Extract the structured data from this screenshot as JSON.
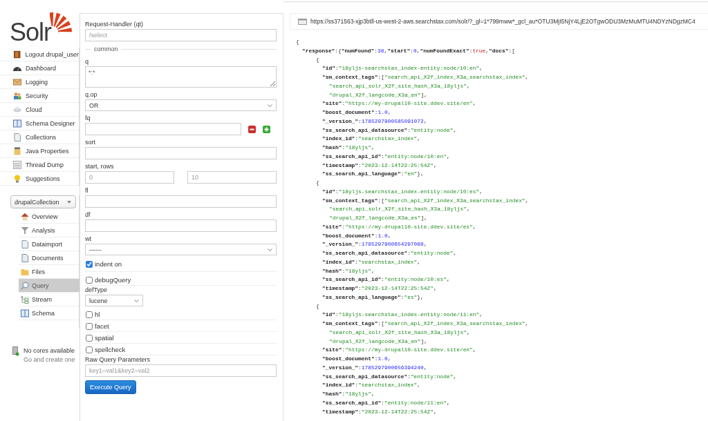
{
  "sidebar": {
    "logo": "Solr",
    "menu": [
      {
        "label": "Logout drupal_user"
      },
      {
        "label": "Dashboard"
      },
      {
        "label": "Logging"
      },
      {
        "label": "Security"
      },
      {
        "label": "Cloud"
      },
      {
        "label": "Schema Designer"
      },
      {
        "label": "Collections"
      },
      {
        "label": "Java Properties"
      },
      {
        "label": "Thread Dump"
      },
      {
        "label": "Suggestions"
      }
    ],
    "core_selector": "drupalCollection",
    "core_menu": [
      {
        "label": "Overview",
        "selected": false
      },
      {
        "label": "Analysis",
        "selected": false
      },
      {
        "label": "Dataimport",
        "selected": false
      },
      {
        "label": "Documents",
        "selected": false
      },
      {
        "label": "Files",
        "selected": false
      },
      {
        "label": "Query",
        "selected": true
      },
      {
        "label": "Stream",
        "selected": false
      },
      {
        "label": "Schema",
        "selected": false
      }
    ],
    "notice": {
      "title": "No cores available",
      "link": "Go and create one"
    }
  },
  "form": {
    "items": [
      {
        "kind": "text",
        "label": "Request-Handler (qt)",
        "placeholder": "/select"
      },
      {
        "kind": "legend",
        "label": "common"
      },
      {
        "kind": "textarea",
        "label": "q",
        "value": "*:*"
      },
      {
        "kind": "select",
        "label": "q.op",
        "value": "OR"
      },
      {
        "kind": "fq",
        "label": "fq"
      },
      {
        "kind": "text",
        "label": "sort"
      },
      {
        "kind": "pair",
        "label": "start, rows",
        "placeholders": [
          "0",
          "10"
        ]
      },
      {
        "kind": "text",
        "label": "fl"
      },
      {
        "kind": "text",
        "label": "df"
      },
      {
        "kind": "select",
        "label": "wt",
        "value": "------"
      },
      {
        "kind": "checkbox",
        "label": "indent on",
        "checked": true
      },
      {
        "kind": "checkbox",
        "label": "debugQuery",
        "checked": false
      },
      {
        "kind": "small-select",
        "label": "defType",
        "value": "lucene"
      },
      {
        "kind": "checkbox",
        "label": "hl",
        "checked": false
      },
      {
        "kind": "checkbox",
        "label": "facet",
        "checked": false
      },
      {
        "kind": "checkbox",
        "label": "spatial",
        "checked": false
      },
      {
        "kind": "checkbox",
        "label": "spellcheck",
        "checked": false
      },
      {
        "kind": "text",
        "label": "Raw Query Parameters",
        "placeholder": "key1=val1&key2=val2"
      },
      {
        "kind": "button",
        "label": "Execute Query"
      }
    ]
  },
  "results": {
    "url": "https://ss371563-xjp3btll-us-west-2-aws.searchstax.com/solr/?_gl=1*799mww*_gcl_au*OTU3MjI5NjY4LjE2OTgwODU3MzMuMTU4NDYzNDgzMC4",
    "lines": [
      {
        "tokens": [
          {
            "kind": "punct",
            "text": "{"
          }
        ],
        "children": [
          {
            "tokens": [
              {
                "kind": "key",
                "text": "\"response\""
              },
              {
                "kind": "punct",
                "text": ":{"
              },
              {
                "kind": "key",
                "text": "\"numFound\""
              },
              {
                "kind": "punct",
                "text": ":"
              },
              {
                "kind": "number",
                "text": "38"
              },
              {
                "kind": "punct",
                "text": ","
              },
              {
                "kind": "key",
                "text": "\"start\""
              },
              {
                "kind": "punct",
                "text": ":"
              },
              {
                "kind": "number",
                "text": "0"
              },
              {
                "kind": "punct",
                "text": ","
              },
              {
                "kind": "key",
                "text": "\"numFoundExact\""
              },
              {
                "kind": "punct",
                "text": ":"
              },
              {
                "kind": "literal",
                "text": "true"
              },
              {
                "kind": "punct",
                "text": ","
              },
              {
                "kind": "key",
                "text": "\"docs\""
              },
              {
                "kind": "punct",
                "text": ":["
              }
            ],
            "children": [
              {
                "tokens": [
                  {
                    "kind": "punct",
                    "text": "{"
                  }
                ],
                "children": [
                  {
                    "tokens": [
                      {
                        "kind": "key",
                        "text": "\"id\""
                      },
                      {
                        "kind": "punct",
                        "text": ":"
                      },
                      {
                        "kind": "string",
                        "text": "\"18yljs-searchstax_index-entity:node/10:en\""
                      },
                      {
                        "kind": "punct",
                        "text": ","
                      }
                    ]
                  },
                  {
                    "tokens": [
                      {
                        "kind": "key",
                        "text": "\"sm_context_tags\""
                      },
                      {
                        "kind": "punct",
                        "text": ":["
                      },
                      {
                        "kind": "string",
                        "text": "\"search_api_X2f_index_X3a_searchstax_index\""
                      },
                      {
                        "kind": "punct",
                        "text": ","
                      }
                    ],
                    "children": [
                      {
                        "tokens": [
                          {
                            "kind": "string",
                            "text": "\"search_api_solr_X2f_site_hash_X3a_18yljs\""
                          },
                          {
                            "kind": "punct",
                            "text": ","
                          }
                        ]
                      },
                      {
                        "tokens": [
                          {
                            "kind": "string",
                            "text": "\"drupal_X2f_langcode_X3a_en\""
                          },
                          {
                            "kind": "punct",
                            "text": "],"
                          }
                        ]
                      }
                    ]
                  },
                  {
                    "tokens": [
                      {
                        "kind": "key",
                        "text": "\"site\""
                      },
                      {
                        "kind": "punct",
                        "text": ":"
                      },
                      {
                        "kind": "string",
                        "text": "\"https://my-drupal10-site.ddev.site/en\""
                      },
                      {
                        "kind": "punct",
                        "text": ","
                      }
                    ]
                  },
                  {
                    "tokens": [
                      {
                        "kind": "key",
                        "text": "\"boost_document\""
                      },
                      {
                        "kind": "punct",
                        "text": ":"
                      },
                      {
                        "kind": "number",
                        "text": "1.0"
                      },
                      {
                        "kind": "punct",
                        "text": ","
                      }
                    ]
                  },
                  {
                    "tokens": [
                      {
                        "kind": "key",
                        "text": "\"_version_\""
                      },
                      {
                        "kind": "punct",
                        "text": ":"
                      },
                      {
                        "kind": "number",
                        "text": "1785297900585091072"
                      },
                      {
                        "kind": "punct",
                        "text": ","
                      }
                    ]
                  },
                  {
                    "tokens": [
                      {
                        "kind": "key",
                        "text": "\"ss_search_api_datasource\""
                      },
                      {
                        "kind": "punct",
                        "text": ":"
                      },
                      {
                        "kind": "string",
                        "text": "\"entity:node\""
                      },
                      {
                        "kind": "punct",
                        "text": ","
                      }
                    ]
                  },
                  {
                    "tokens": [
                      {
                        "kind": "key",
                        "text": "\"index_id\""
                      },
                      {
                        "kind": "punct",
                        "text": ":"
                      },
                      {
                        "kind": "string",
                        "text": "\"searchstax_index\""
                      },
                      {
                        "kind": "punct",
                        "text": ","
                      }
                    ]
                  },
                  {
                    "tokens": [
                      {
                        "kind": "key",
                        "text": "\"hash\""
                      },
                      {
                        "kind": "punct",
                        "text": ":"
                      },
                      {
                        "kind": "string",
                        "text": "\"18yljs\""
                      },
                      {
                        "kind": "punct",
                        "text": ","
                      }
                    ]
                  },
                  {
                    "tokens": [
                      {
                        "kind": "key",
                        "text": "\"ss_search_api_id\""
                      },
                      {
                        "kind": "punct",
                        "text": ":"
                      },
                      {
                        "kind": "string",
                        "text": "\"entity:node/10:en\""
                      },
                      {
                        "kind": "punct",
                        "text": ","
                      }
                    ]
                  },
                  {
                    "tokens": [
                      {
                        "kind": "key",
                        "text": "\"timestamp\""
                      },
                      {
                        "kind": "punct",
                        "text": ":"
                      },
                      {
                        "kind": "string",
                        "text": "\"2023-12-14T22:25:54Z\""
                      },
                      {
                        "kind": "punct",
                        "text": ","
                      }
                    ]
                  },
                  {
                    "tokens": [
                      {
                        "kind": "key",
                        "text": "\"ss_search_api_language\""
                      },
                      {
                        "kind": "punct",
                        "text": ":"
                      },
                      {
                        "kind": "string",
                        "text": "\"en\""
                      },
                      {
                        "kind": "punct",
                        "text": "},"
                      }
                    ]
                  }
                ]
              },
              {
                "tokens": [
                  {
                    "kind": "punct",
                    "text": "{"
                  }
                ],
                "children": [
                  {
                    "tokens": [
                      {
                        "kind": "key",
                        "text": "\"id\""
                      },
                      {
                        "kind": "punct",
                        "text": ":"
                      },
                      {
                        "kind": "string",
                        "text": "\"18yljs-searchstax_index-entity:node/10:es\""
                      },
                      {
                        "kind": "punct",
                        "text": ","
                      }
                    ]
                  },
                  {
                    "tokens": [
                      {
                        "kind": "key",
                        "text": "\"sm_context_tags\""
                      },
                      {
                        "kind": "punct",
                        "text": ":["
                      },
                      {
                        "kind": "string",
                        "text": "\"search_api_X2f_index_X3a_searchstax_index\""
                      },
                      {
                        "kind": "punct",
                        "text": ","
                      }
                    ],
                    "children": [
                      {
                        "tokens": [
                          {
                            "kind": "string",
                            "text": "\"search_api_solr_X2f_site_hash_X3a_18yljs\""
                          },
                          {
                            "kind": "punct",
                            "text": ","
                          }
                        ]
                      },
                      {
                        "tokens": [
                          {
                            "kind": "string",
                            "text": "\"drupal_X2f_langcode_X3a_es\""
                          },
                          {
                            "kind": "punct",
                            "text": "],"
                          }
                        ]
                      }
                    ]
                  },
                  {
                    "tokens": [
                      {
                        "kind": "key",
                        "text": "\"site\""
                      },
                      {
                        "kind": "punct",
                        "text": ":"
                      },
                      {
                        "kind": "string",
                        "text": "\"https://my-drupal10-site.ddev.site/es\""
                      },
                      {
                        "kind": "punct",
                        "text": ","
                      }
                    ]
                  },
                  {
                    "tokens": [
                      {
                        "kind": "key",
                        "text": "\"boost_document\""
                      },
                      {
                        "kind": "punct",
                        "text": ":"
                      },
                      {
                        "kind": "number",
                        "text": "1.0"
                      },
                      {
                        "kind": "punct",
                        "text": ","
                      }
                    ]
                  },
                  {
                    "tokens": [
                      {
                        "kind": "key",
                        "text": "\"_version_\""
                      },
                      {
                        "kind": "punct",
                        "text": ":"
                      },
                      {
                        "kind": "number",
                        "text": "1785297900654297088"
                      },
                      {
                        "kind": "punct",
                        "text": ","
                      }
                    ]
                  },
                  {
                    "tokens": [
                      {
                        "kind": "key",
                        "text": "\"ss_search_api_datasource\""
                      },
                      {
                        "kind": "punct",
                        "text": ":"
                      },
                      {
                        "kind": "string",
                        "text": "\"entity:node\""
                      },
                      {
                        "kind": "punct",
                        "text": ","
                      }
                    ]
                  },
                  {
                    "tokens": [
                      {
                        "kind": "key",
                        "text": "\"index_id\""
                      },
                      {
                        "kind": "punct",
                        "text": ":"
                      },
                      {
                        "kind": "string",
                        "text": "\"searchstax_index\""
                      },
                      {
                        "kind": "punct",
                        "text": ","
                      }
                    ]
                  },
                  {
                    "tokens": [
                      {
                        "kind": "key",
                        "text": "\"hash\""
                      },
                      {
                        "kind": "punct",
                        "text": ":"
                      },
                      {
                        "kind": "string",
                        "text": "\"18yljs\""
                      },
                      {
                        "kind": "punct",
                        "text": ","
                      }
                    ]
                  },
                  {
                    "tokens": [
                      {
                        "kind": "key",
                        "text": "\"ss_search_api_id\""
                      },
                      {
                        "kind": "punct",
                        "text": ":"
                      },
                      {
                        "kind": "string",
                        "text": "\"entity:node/10:es\""
                      },
                      {
                        "kind": "punct",
                        "text": ","
                      }
                    ]
                  },
                  {
                    "tokens": [
                      {
                        "kind": "key",
                        "text": "\"timestamp\""
                      },
                      {
                        "kind": "punct",
                        "text": ":"
                      },
                      {
                        "kind": "string",
                        "text": "\"2023-12-14T22:25:54Z\""
                      },
                      {
                        "kind": "punct",
                        "text": ","
                      }
                    ]
                  },
                  {
                    "tokens": [
                      {
                        "kind": "key",
                        "text": "\"ss_search_api_language\""
                      },
                      {
                        "kind": "punct",
                        "text": ":"
                      },
                      {
                        "kind": "string",
                        "text": "\"es\""
                      },
                      {
                        "kind": "punct",
                        "text": "},"
                      }
                    ]
                  }
                ]
              },
              {
                "tokens": [
                  {
                    "kind": "punct",
                    "text": "{"
                  }
                ],
                "children": [
                  {
                    "tokens": [
                      {
                        "kind": "key",
                        "text": "\"id\""
                      },
                      {
                        "kind": "punct",
                        "text": ":"
                      },
                      {
                        "kind": "string",
                        "text": "\"18yljs-searchstax_index-entity:node/11:en\""
                      },
                      {
                        "kind": "punct",
                        "text": ","
                      }
                    ]
                  },
                  {
                    "tokens": [
                      {
                        "kind": "key",
                        "text": "\"sm_context_tags\""
                      },
                      {
                        "kind": "punct",
                        "text": ":["
                      },
                      {
                        "kind": "string",
                        "text": "\"search_api_X2f_index_X3a_searchstax_index\""
                      },
                      {
                        "kind": "punct",
                        "text": ","
                      }
                    ],
                    "children": [
                      {
                        "tokens": [
                          {
                            "kind": "string",
                            "text": "\"search_api_solr_X2f_site_hash_X3a_18yljs\""
                          },
                          {
                            "kind": "punct",
                            "text": ","
                          }
                        ]
                      },
                      {
                        "tokens": [
                          {
                            "kind": "string",
                            "text": "\"drupal_X2f_langcode_X3a_en\""
                          },
                          {
                            "kind": "punct",
                            "text": "],"
                          }
                        ]
                      }
                    ]
                  },
                  {
                    "tokens": [
                      {
                        "kind": "key",
                        "text": "\"site\""
                      },
                      {
                        "kind": "punct",
                        "text": ":"
                      },
                      {
                        "kind": "string",
                        "text": "\"https://my-drupal10-site.ddev.site/en\""
                      },
                      {
                        "kind": "punct",
                        "text": ","
                      }
                    ]
                  },
                  {
                    "tokens": [
                      {
                        "kind": "key",
                        "text": "\"boost_document\""
                      },
                      {
                        "kind": "punct",
                        "text": ":"
                      },
                      {
                        "kind": "number",
                        "text": "1.0"
                      },
                      {
                        "kind": "punct",
                        "text": ","
                      }
                    ]
                  },
                  {
                    "tokens": [
                      {
                        "kind": "key",
                        "text": "\"_version_\""
                      },
                      {
                        "kind": "punct",
                        "text": ":"
                      },
                      {
                        "kind": "number",
                        "text": "1785297900656394240"
                      },
                      {
                        "kind": "punct",
                        "text": ","
                      }
                    ]
                  },
                  {
                    "tokens": [
                      {
                        "kind": "key",
                        "text": "\"ss_search_api_datasource\""
                      },
                      {
                        "kind": "punct",
                        "text": ":"
                      },
                      {
                        "kind": "string",
                        "text": "\"entity:node\""
                      },
                      {
                        "kind": "punct",
                        "text": ","
                      }
                    ]
                  },
                  {
                    "tokens": [
                      {
                        "kind": "key",
                        "text": "\"index_id\""
                      },
                      {
                        "kind": "punct",
                        "text": ":"
                      },
                      {
                        "kind": "string",
                        "text": "\"searchstax_index\""
                      },
                      {
                        "kind": "punct",
                        "text": ","
                      }
                    ]
                  },
                  {
                    "tokens": [
                      {
                        "kind": "key",
                        "text": "\"hash\""
                      },
                      {
                        "kind": "punct",
                        "text": ":"
                      },
                      {
                        "kind": "string",
                        "text": "\"18yljs\""
                      },
                      {
                        "kind": "punct",
                        "text": ","
                      }
                    ]
                  },
                  {
                    "tokens": [
                      {
                        "kind": "key",
                        "text": "\"ss_search_api_id\""
                      },
                      {
                        "kind": "punct",
                        "text": ":"
                      },
                      {
                        "kind": "string",
                        "text": "\"entity:node/11:en\""
                      },
                      {
                        "kind": "punct",
                        "text": ","
                      }
                    ]
                  },
                  {
                    "tokens": [
                      {
                        "kind": "key",
                        "text": "\"timestamp\""
                      },
                      {
                        "kind": "punct",
                        "text": ":"
                      },
                      {
                        "kind": "string",
                        "text": "\"2023-12-14T22:25:54Z\""
                      },
                      {
                        "kind": "punct",
                        "text": ","
                      }
                    ]
                  }
                ]
              }
            ]
          }
        ]
      }
    ]
  }
}
